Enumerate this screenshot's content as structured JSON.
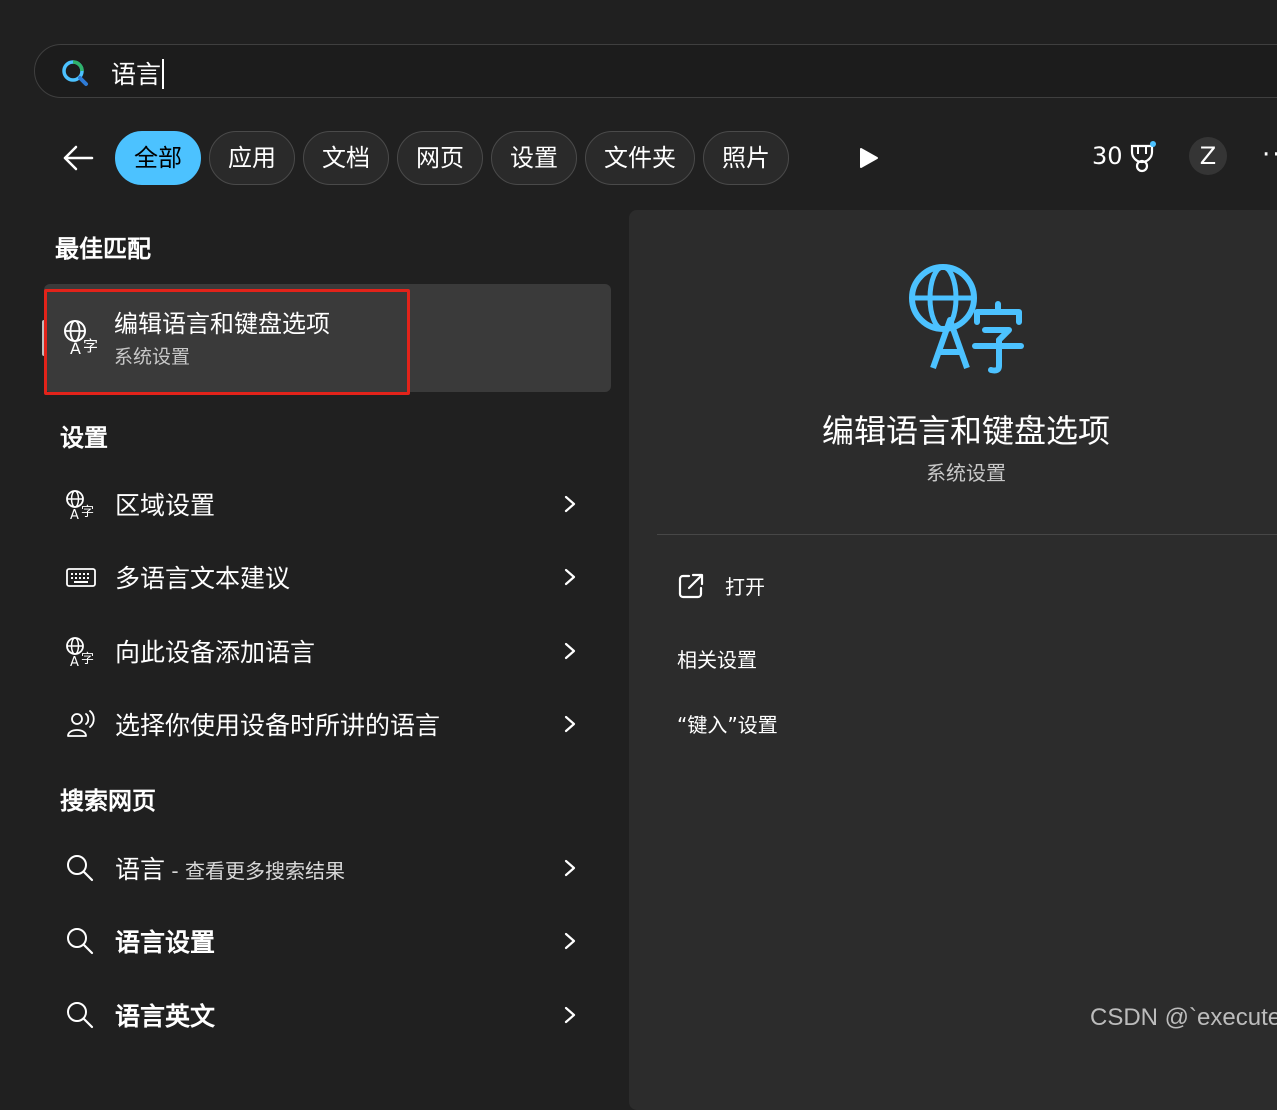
{
  "search": {
    "query": "语言"
  },
  "filters": {
    "tabs": [
      {
        "label": "全部",
        "active": true
      },
      {
        "label": "应用",
        "active": false
      },
      {
        "label": "文档",
        "active": false
      },
      {
        "label": "网页",
        "active": false
      },
      {
        "label": "设置",
        "active": false
      },
      {
        "label": "文件夹",
        "active": false
      },
      {
        "label": "照片",
        "active": false
      }
    ]
  },
  "header": {
    "points": "30",
    "avatar_initial": "Z",
    "more": "··"
  },
  "best_match": {
    "section_title": "最佳匹配",
    "title": "编辑语言和键盘选项",
    "subtitle": "系统设置",
    "icon": "language-icon"
  },
  "settings": {
    "section_title": "设置",
    "items": [
      {
        "label": "区域设置",
        "icon": "language-icon"
      },
      {
        "label": "多语言文本建议",
        "icon": "keyboard-icon"
      },
      {
        "label": "向此设备添加语言",
        "icon": "language-icon"
      },
      {
        "label": "选择你使用设备时所讲的语言",
        "icon": "speech-icon"
      }
    ]
  },
  "web": {
    "section_title": "搜索网页",
    "items": [
      {
        "label": "语言",
        "suffix": " - 查看更多搜索结果",
        "icon": "search-icon"
      },
      {
        "label": "语言设置",
        "icon": "search-icon"
      },
      {
        "label": "语言英文",
        "icon": "search-icon"
      }
    ]
  },
  "detail": {
    "title": "编辑语言和键盘选项",
    "subtitle": "系统设置",
    "open_label": "打开",
    "related_title": "相关设置",
    "related_items": [
      "“键入”设置"
    ]
  },
  "watermark": "CSDN @`execute",
  "colors": {
    "accent": "#4cc2ff",
    "highlight_border": "#e2231a",
    "background": "#202020",
    "panel": "#2c2c2c"
  }
}
